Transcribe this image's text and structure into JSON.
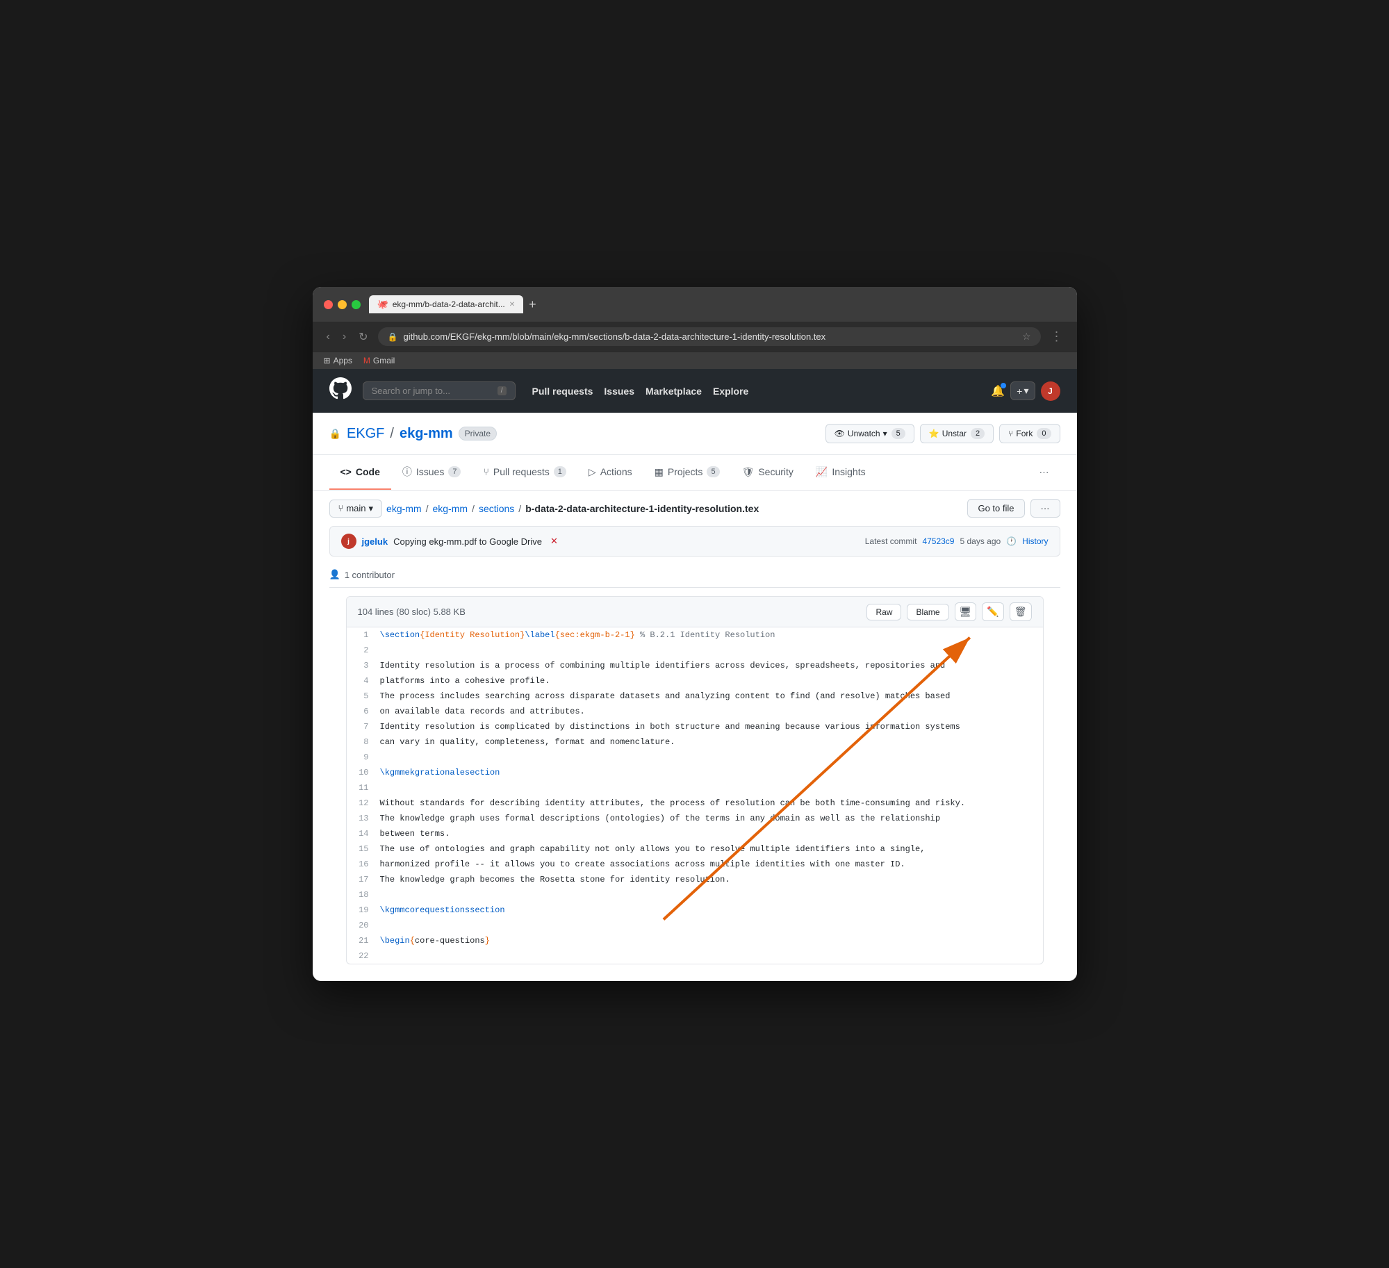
{
  "browser": {
    "tab_title": "ekg-mm/b-data-2-data-archit...",
    "url": "github.com/EKGF/ekg-mm/blob/main/ekg-mm/sections/b-data-2-data-architecture-1-identity-resolution.tex",
    "bookmarks": [
      "Apps",
      "Gmail"
    ]
  },
  "github": {
    "nav": {
      "search_placeholder": "Search or jump to...",
      "links": [
        "Pull requests",
        "Issues",
        "Marketplace",
        "Explore"
      ]
    },
    "repo": {
      "org": "EKGF",
      "name": "ekg-mm",
      "visibility": "Private",
      "watch_label": "Unwatch",
      "watch_count": "5",
      "star_label": "Unstar",
      "star_count": "2",
      "fork_label": "Fork",
      "fork_count": "0"
    },
    "tabs": [
      {
        "label": "Code",
        "icon": "<>",
        "active": true
      },
      {
        "label": "Issues",
        "count": "7"
      },
      {
        "label": "Pull requests",
        "count": "1"
      },
      {
        "label": "Actions"
      },
      {
        "label": "Projects",
        "count": "5"
      },
      {
        "label": "Security"
      },
      {
        "label": "Insights"
      }
    ],
    "breadcrumb": {
      "branch": "main",
      "path": [
        "ekg-mm",
        "ekg-mm",
        "sections"
      ],
      "filename": "b-data-2-data-architecture-1-identity-resolution.tex"
    },
    "commit": {
      "author": "jgeluk",
      "message": "Copying ekg-mm.pdf to Google Drive",
      "hash": "47523c9",
      "time": "5 days ago",
      "history_label": "History"
    },
    "contributors": "1 contributor",
    "file": {
      "stats": "104 lines (80 sloc)   5.88 KB",
      "actions": [
        "Raw",
        "Blame"
      ],
      "lines": [
        {
          "num": 1,
          "content": "\\section{Identity Resolution}\\label{sec:ekgm-b-2-1} % B.2.1 Identity Resolution",
          "type": "latex"
        },
        {
          "num": 2,
          "content": "",
          "type": "plain"
        },
        {
          "num": 3,
          "content": "Identity resolution is a process of combining multiple identifiers across devices, spreadsheets, repositories and",
          "type": "plain"
        },
        {
          "num": 4,
          "content": "platforms into a cohesive profile.",
          "type": "plain"
        },
        {
          "num": 5,
          "content": "The process includes searching across disparate datasets and analyzing content to find (and resolve) matches based",
          "type": "plain"
        },
        {
          "num": 6,
          "content": "on available data records and attributes.",
          "type": "plain"
        },
        {
          "num": 7,
          "content": "Identity resolution is complicated by distinctions in both structure and meaning because various information systems",
          "type": "plain"
        },
        {
          "num": 8,
          "content": "can vary in quality, completeness, format and nomenclature.",
          "type": "plain"
        },
        {
          "num": 9,
          "content": "",
          "type": "plain"
        },
        {
          "num": 10,
          "content": "\\kgmmekgrationalesection",
          "type": "macro"
        },
        {
          "num": 11,
          "content": "",
          "type": "plain"
        },
        {
          "num": 12,
          "content": "Without standards for describing identity attributes, the process of resolution can be both time-consuming and risky.",
          "type": "plain"
        },
        {
          "num": 13,
          "content": "The knowledge graph uses formal descriptions (ontologies) of the terms in any domain as well as the relationship",
          "type": "plain"
        },
        {
          "num": 14,
          "content": "between terms.",
          "type": "plain"
        },
        {
          "num": 15,
          "content": "The use of ontologies and graph capability not only allows you to resolve multiple identifiers into a single,",
          "type": "plain"
        },
        {
          "num": 16,
          "content": "harmonized profile -- it allows you to create associations across multiple identities with one master ID.",
          "type": "plain"
        },
        {
          "num": 17,
          "content": "The knowledge graph becomes the Rosetta stone for identity resolution.",
          "type": "plain"
        },
        {
          "num": 18,
          "content": "",
          "type": "plain"
        },
        {
          "num": 19,
          "content": "\\kgmmcorequestionssection",
          "type": "macro"
        },
        {
          "num": 20,
          "content": "",
          "type": "plain"
        },
        {
          "num": 21,
          "content": "\\begin{core-questions}",
          "type": "latex"
        },
        {
          "num": 22,
          "content": "",
          "type": "plain"
        }
      ]
    }
  }
}
